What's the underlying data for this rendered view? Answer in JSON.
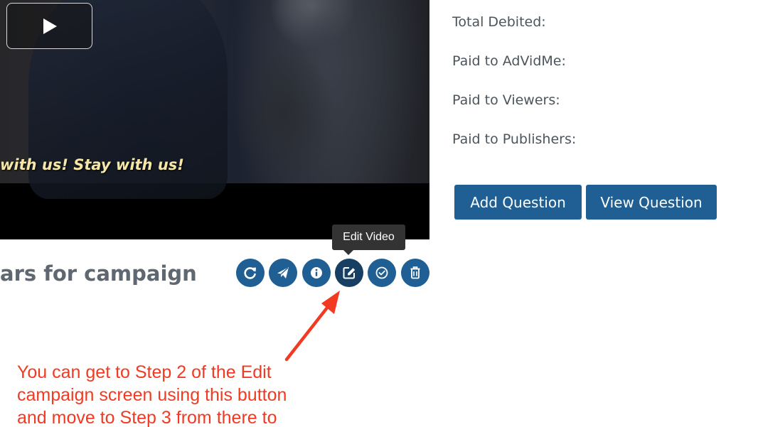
{
  "video": {
    "subtitle": "with us! Stay with us!"
  },
  "campaign": {
    "title": "ars for campaign"
  },
  "tooltip": {
    "text": "Edit Video"
  },
  "actions": [
    {
      "name": "refresh",
      "icon": "refresh-icon"
    },
    {
      "name": "publish",
      "icon": "paper-plane-icon"
    },
    {
      "name": "info",
      "icon": "info-icon"
    },
    {
      "name": "edit-video",
      "icon": "edit-icon"
    },
    {
      "name": "approve",
      "icon": "check-circle-icon"
    },
    {
      "name": "delete",
      "icon": "trash-icon"
    }
  ],
  "stats": {
    "total_debited": "Total Debited:",
    "paid_to_advidme": "Paid to AdVidMe:",
    "paid_to_viewers": "Paid to Viewers:",
    "paid_to_publishers": "Paid to Publishers:"
  },
  "buttons": {
    "add_question": "Add Question",
    "view_question": "View Question"
  },
  "annotation": {
    "line1": "You can get to Step 2 of the Edit",
    "line2": "campaign screen using this button",
    "line3": "and move to Step 3 from there to"
  },
  "colors": {
    "primary": "#1f5f94",
    "primary_active": "#163f63",
    "annotation": "#f23a22",
    "label_text": "#4c545c"
  }
}
